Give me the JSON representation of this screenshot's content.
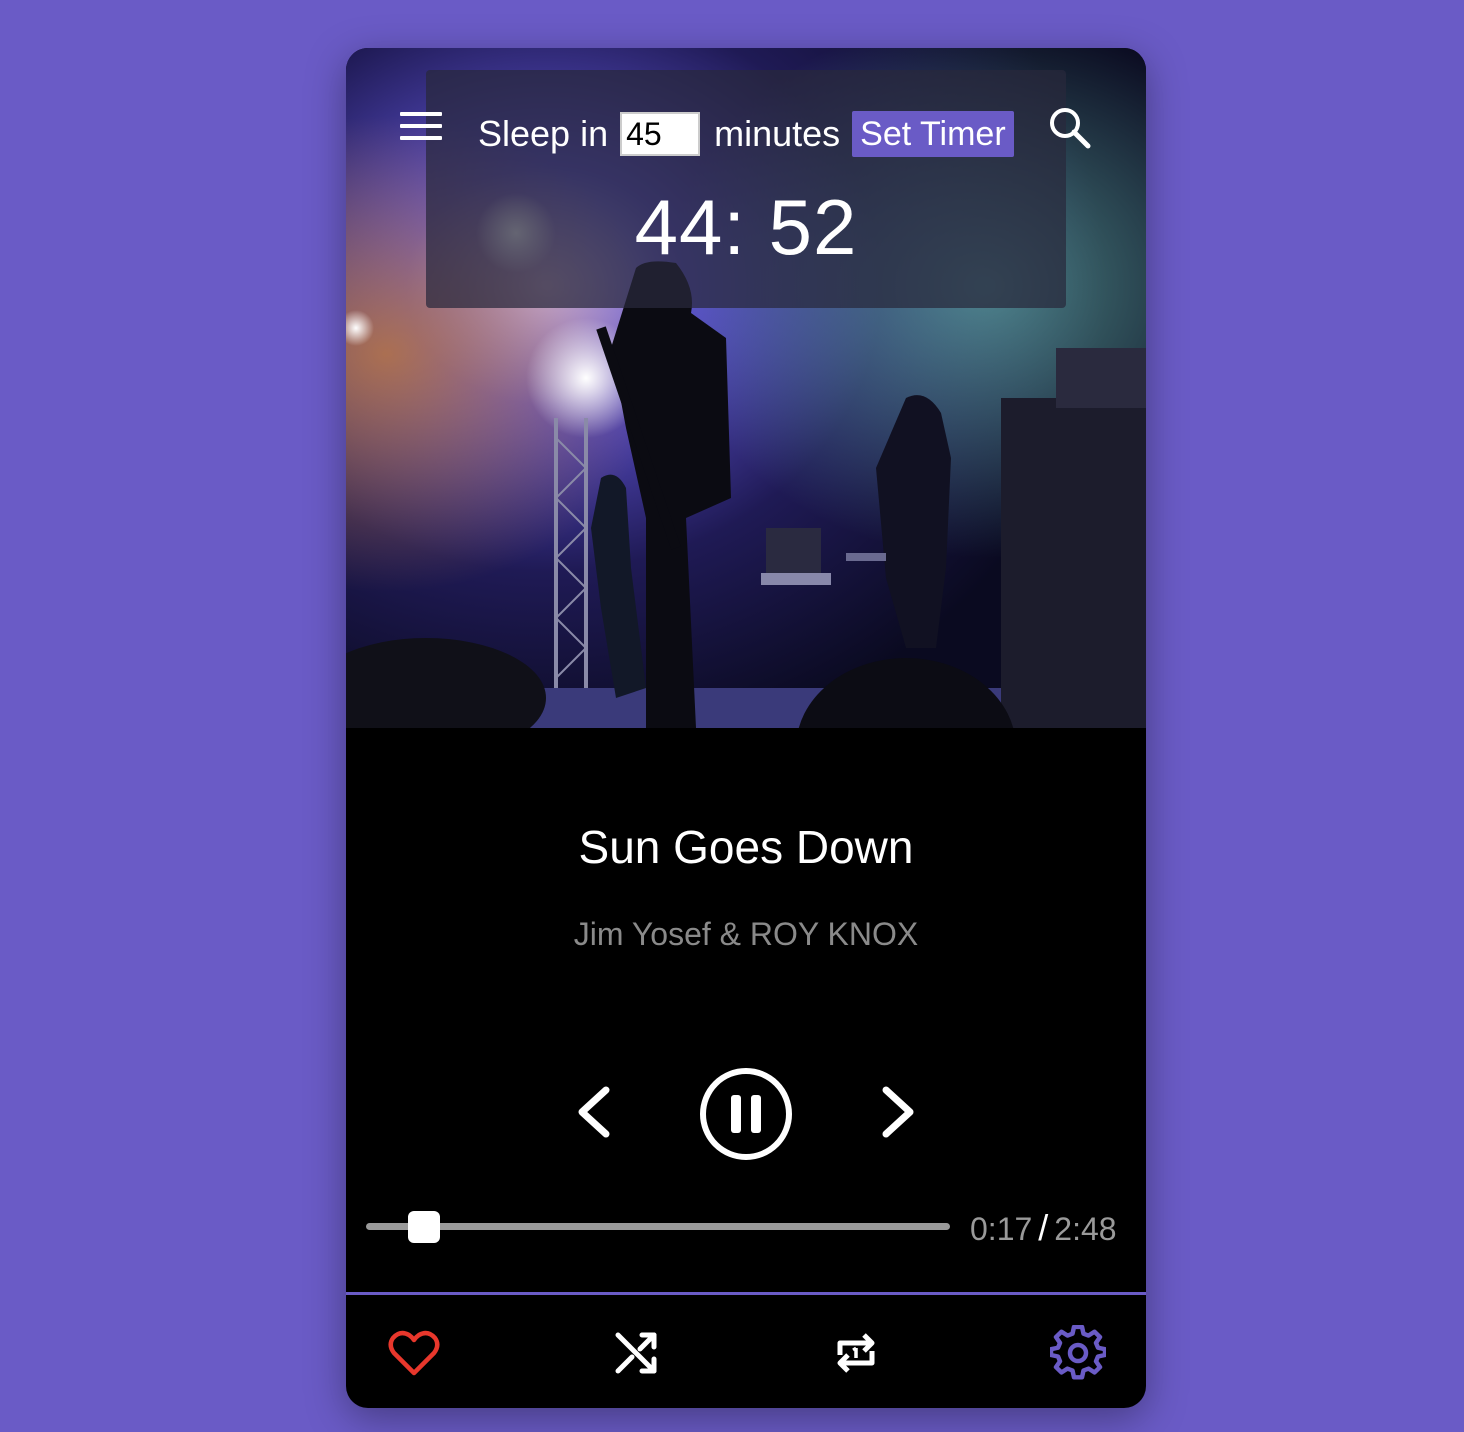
{
  "timer": {
    "label_prefix": "Sleep in",
    "minutes_value": "45",
    "label_suffix": "minutes",
    "button_label": "Set Timer",
    "countdown": "44: 52"
  },
  "track": {
    "title": "Sun Goes Down",
    "artist": "Jim Yosef & ROY KNOX"
  },
  "playback": {
    "state": "playing",
    "progress_fraction": 0.1,
    "elapsed": "0:17",
    "separator": "/",
    "duration": "2:48"
  },
  "icons": {
    "menu": "hamburger-menu-icon",
    "search": "search-icon",
    "previous": "chevron-left-icon",
    "pause": "pause-circle-icon",
    "next": "chevron-right-icon",
    "favorite": "heart-icon",
    "shuffle": "shuffle-icon",
    "repeat": "repeat-one-icon",
    "settings": "gear-icon"
  },
  "colors": {
    "background": "#6a5bc6",
    "accent": "#6a5bc6",
    "heart": "#e8372c",
    "player_bg": "#000000",
    "muted_text": "#8a8a8a"
  }
}
